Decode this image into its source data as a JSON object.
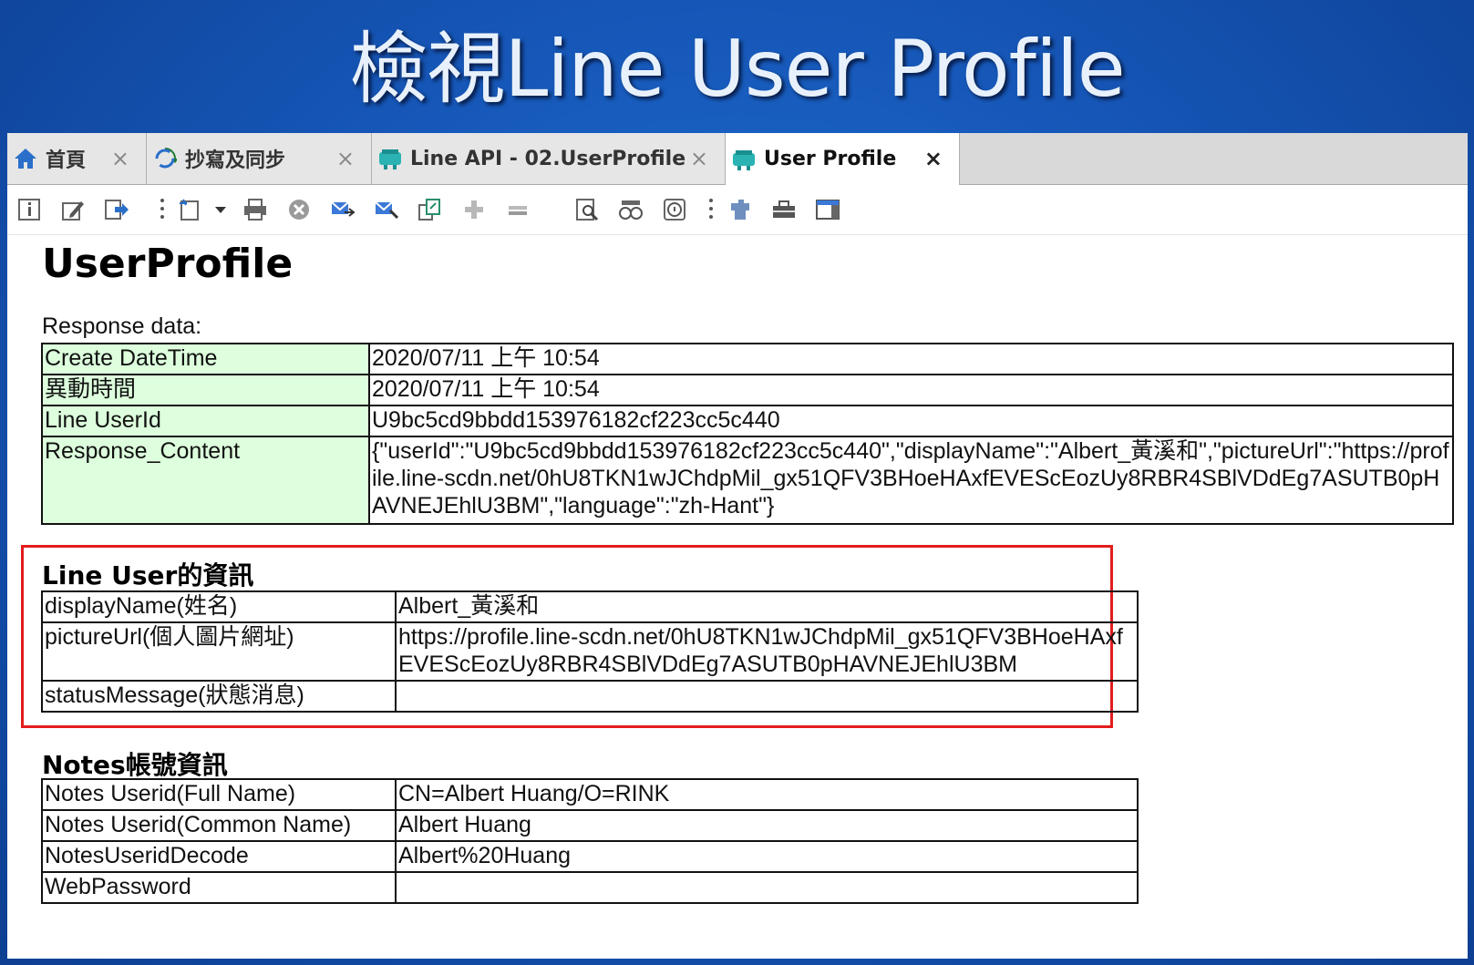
{
  "slide": {
    "title": "檢視Line User Profile"
  },
  "tabs": [
    {
      "label": "首頁",
      "icon": "home-icon"
    },
    {
      "label": "抄寫及同步",
      "icon": "sync-icon"
    },
    {
      "label": "Line API - 02.UserProfile",
      "icon": "database-icon"
    },
    {
      "label": "User Profile",
      "icon": "database-icon",
      "active": true
    }
  ],
  "tab_close_glyph": "×",
  "form": {
    "title": "UserProfile",
    "response_label": "Response data:",
    "response_rows": [
      {
        "key": "Create DateTime",
        "value": "2020/07/11 上午 10:54"
      },
      {
        "key": "異動時間",
        "value": "2020/07/11 上午 10:54"
      },
      {
        "key": "Line UserId",
        "value": "U9bc5cd9bbdd153976182cf223cc5c440"
      },
      {
        "key": "Response_Content",
        "value": "{\"userId\":\"U9bc5cd9bbdd153976182cf223cc5c440\",\"displayName\":\"Albert_黃溪和\",\"pictureUrl\":\"https://profile.line-scdn.net/0hU8TKN1wJChdpMil_gx51QFV3BHoeHAxfEVEScEozUy8RBR4SBlVDdEg7ASUTB0pHAVNEJEhlU3BM\",\"language\":\"zh-Hant\"}"
      }
    ],
    "line_user": {
      "title": "Line User的資訊",
      "rows": [
        {
          "key": "displayName(姓名)",
          "value": "Albert_黃溪和"
        },
        {
          "key": "pictureUrl(個人圖片網址)",
          "value": "https://profile.line-scdn.net/0hU8TKN1wJChdpMil_gx51QFV3BHoeHAxfEVEScEozUy8RBR4SBlVDdEg7ASUTB0pHAVNEJEhlU3BM"
        },
        {
          "key": "statusMessage(狀態消息)",
          "value": ""
        }
      ]
    },
    "notes": {
      "title": "Notes帳號資訊",
      "rows": [
        {
          "key": "Notes Userid(Full Name)",
          "value": "CN=Albert Huang/O=RINK"
        },
        {
          "key": "Notes Userid(Common Name)",
          "value": "Albert Huang"
        },
        {
          "key": "NotesUseridDecode",
          "value": "Albert%20Huang"
        },
        {
          "key": "WebPassword",
          "value": ""
        }
      ]
    }
  },
  "colors": {
    "key_cell_bg": "#ddffdd",
    "highlight_border": "#e21d1d",
    "slide_bg": "#1657b8"
  }
}
